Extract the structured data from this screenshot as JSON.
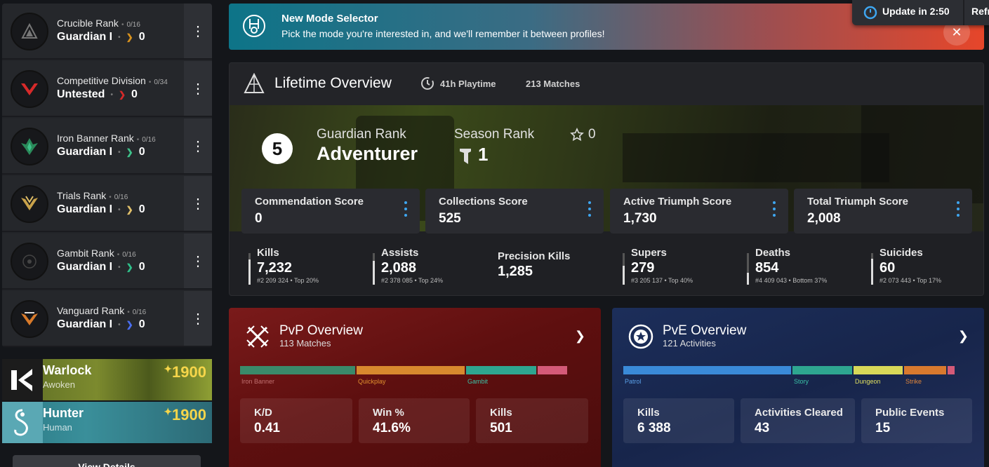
{
  "ranks": [
    {
      "name": "Crucible Rank",
      "count": "0/16",
      "tier": "Guardian I",
      "value": "0",
      "color": "#d8921e"
    },
    {
      "name": "Competitive Division",
      "count": "0/34",
      "tier": "Untested",
      "value": "0",
      "color": "#d72a2a"
    },
    {
      "name": "Iron Banner Rank",
      "count": "0/16",
      "tier": "Guardian I",
      "value": "0",
      "color": "#3ec28a"
    },
    {
      "name": "Trials Rank",
      "count": "0/16",
      "tier": "Guardian I",
      "value": "0",
      "color": "#e0c06a"
    },
    {
      "name": "Gambit Rank",
      "count": "0/16",
      "tier": "Guardian I",
      "value": "0",
      "color": "#2fc08a"
    },
    {
      "name": "Vanguard Rank",
      "count": "0/16",
      "tier": "Guardian I",
      "value": "0",
      "color": "#4a6ef0"
    }
  ],
  "characters": [
    {
      "class": "Warlock",
      "race": "Awoken",
      "light": "1900"
    },
    {
      "class": "Hunter",
      "race": "Human",
      "light": "1900"
    }
  ],
  "view_details": "View Details",
  "banner": {
    "title": "New Mode Selector",
    "text": "Pick the mode you're interested in, and we'll remember it between profiles!"
  },
  "update": {
    "label": "Update in 2:50",
    "refresh": "Refresh"
  },
  "lifetime": {
    "title": "Lifetime Overview",
    "playtime": "41h Playtime",
    "matches": "213 Matches",
    "guardian_rank_number": "5",
    "guardian_rank_label": "Guardian Rank",
    "guardian_rank_value": "Adventurer",
    "season_rank_label": "Season Rank",
    "season_rank_value": "1",
    "star_value": "0",
    "scores": [
      {
        "label": "Commendation Score",
        "value": "0"
      },
      {
        "label": "Collections Score",
        "value": "525"
      },
      {
        "label": "Active Triumph Score",
        "value": "1,730"
      },
      {
        "label": "Total Triumph Score",
        "value": "2,008"
      }
    ],
    "stats": [
      {
        "label": "Kills",
        "value": "7,232",
        "rank": "#2 209 324 • Top 20%",
        "fill": 0.8
      },
      {
        "label": "Assists",
        "value": "2,088",
        "rank": "#2 378 085 • Top 24%",
        "fill": 0.76
      },
      {
        "label": "Precision Kills",
        "value": "1,285",
        "rank": "",
        "fill": 0
      },
      {
        "label": "Supers",
        "value": "279",
        "rank": "#3 205 137 • Top 40%",
        "fill": 0.6
      },
      {
        "label": "Deaths",
        "value": "854",
        "rank": "#4 409 043 • Bottom 37%",
        "fill": 0.37
      },
      {
        "label": "Suicides",
        "value": "60",
        "rank": "#2 073 443 • Top 17%",
        "fill": 0.83
      }
    ]
  },
  "pvp": {
    "title": "PvP Overview",
    "subtitle": "113 Matches",
    "segments": [
      {
        "label": "Iron Banner",
        "share": 0.33,
        "color": "#3a8a6a",
        "label_color": "#c07070"
      },
      {
        "label": "Quickplay",
        "share": 0.31,
        "color": "#d8892e",
        "label_color": "#e0902e"
      },
      {
        "label": "Gambit",
        "share": 0.2,
        "color": "#2ea690",
        "label_color": "#3ac2a6"
      },
      {
        "label": "",
        "share": 0.085,
        "color": "#d45a78",
        "label_color": "#d45a78"
      }
    ],
    "cards": [
      {
        "label": "K/D",
        "value": "0.41"
      },
      {
        "label": "Win %",
        "value": "41.6%"
      },
      {
        "label": "Kills",
        "value": "501"
      }
    ]
  },
  "pve": {
    "title": "PvE Overview",
    "subtitle": "121 Activities",
    "segments": [
      {
        "label": "Patrol",
        "share": 0.48,
        "color": "#3a8ad8",
        "label_color": "#5aa0e8"
      },
      {
        "label": "Story",
        "share": 0.17,
        "color": "#2ea690",
        "label_color": "#3ac2a6"
      },
      {
        "label": "Dungeon",
        "share": 0.14,
        "color": "#d8d858",
        "label_color": "#e0e060"
      },
      {
        "label": "Strike",
        "share": 0.12,
        "color": "#d8792e",
        "label_color": "#e0863a"
      },
      {
        "label": "",
        "share": 0.02,
        "color": "#d45a78",
        "label_color": "#d45a78"
      }
    ],
    "cards": [
      {
        "label": "Kills",
        "value": "6 388"
      },
      {
        "label": "Activities Cleared",
        "value": "43"
      },
      {
        "label": "Public Events",
        "value": "15"
      }
    ]
  }
}
